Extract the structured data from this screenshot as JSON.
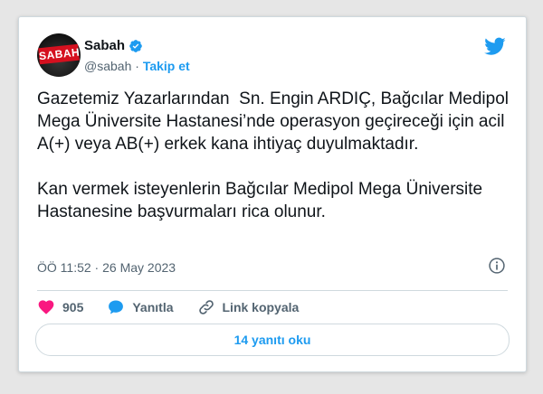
{
  "account": {
    "name": "Sabah",
    "handle": "@sabah",
    "separator": "·",
    "follow_label": "Takip et",
    "avatar_logo_text": "SABAH"
  },
  "tweet": {
    "text": "Gazetemiz Yazarlarından  Sn. Engin ARDIÇ, Bağcılar Medipol Mega Üniversite Hastanesi’nde operasyon geçireceği için acil  A(+) veya AB(+) erkek kana ihtiyaç duyulmaktadır.\n\nKan vermek isteyenlerin Bağcılar Medipol Mega Üniversite Hastanesine başvurmaları rica olunur.",
    "timestamp": "ÖÖ 11:52 · 26 May 2023"
  },
  "actions": {
    "like_count": "905",
    "reply_label": "Yanıtla",
    "copy_link_label": "Link kopyala"
  },
  "replies_button_label": "14 yanıtı oku",
  "icons": {
    "verified": "verified-badge-icon",
    "brand": "twitter-bird-icon",
    "info": "info-icon",
    "like": "heart-icon",
    "reply": "speech-bubble-icon",
    "link": "link-icon"
  },
  "colors": {
    "accent": "#1d9bf0",
    "like": "#f91880",
    "text": "#0f1419",
    "muted": "#536471",
    "brand_red": "#d5101f"
  }
}
